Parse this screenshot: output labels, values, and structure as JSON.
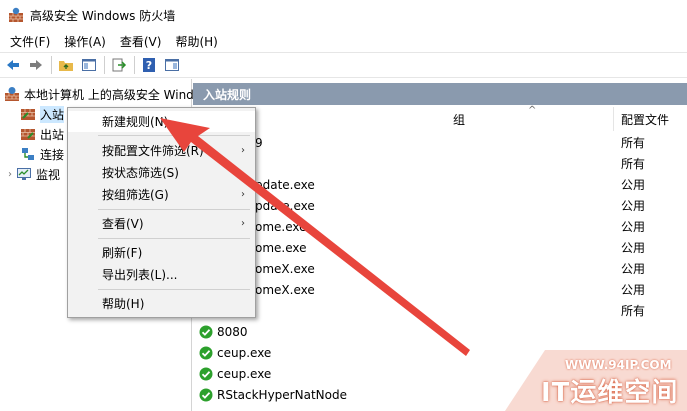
{
  "window": {
    "title": "高级安全 Windows 防火墙"
  },
  "menubar": [
    "文件(F)",
    "操作(A)",
    "查看(V)",
    "帮助(H)"
  ],
  "toolbar": {
    "icons": [
      "back-arrow-icon",
      "forward-arrow-icon",
      "folder-up-icon",
      "show-hide-tree-icon",
      "export-icon",
      "help-icon",
      "properties-icon"
    ]
  },
  "tree": {
    "root": "本地计算机 上的高级安全 Wind",
    "items": [
      {
        "label": "入站",
        "selected": true
      },
      {
        "label": "出站"
      },
      {
        "label": "连接"
      },
      {
        "label": "监视"
      }
    ]
  },
  "right": {
    "header": "入站规则",
    "columns": {
      "group": "组",
      "profile": "配置文件"
    },
    "rows": [
      {
        "name": "9",
        "profile": "所有",
        "icon": false
      },
      {
        "name": "",
        "profile": "所有",
        "icon": false
      },
      {
        "name": "pdate.exe",
        "profile": "公用",
        "icon": false
      },
      {
        "name": "pdate.exe",
        "profile": "公用",
        "icon": false
      },
      {
        "name": "ome.exe",
        "profile": "公用",
        "icon": false
      },
      {
        "name": "ome.exe",
        "profile": "公用",
        "icon": false
      },
      {
        "name": "omeX.exe",
        "profile": "公用",
        "icon": false
      },
      {
        "name": "omeX.exe",
        "profile": "公用",
        "icon": false
      },
      {
        "name": "",
        "profile": "所有",
        "icon": false
      },
      {
        "name": "8080",
        "profile": "",
        "icon": true
      },
      {
        "name": "ceup.exe",
        "profile": "",
        "icon": true
      },
      {
        "name": "ceup.exe",
        "profile": "",
        "icon": true
      },
      {
        "name": "RStackHyperNatNode",
        "profile": "",
        "icon": true
      }
    ]
  },
  "context_menu": {
    "items": [
      {
        "label": "新建规则(N)...",
        "submenu": false
      },
      {
        "label": "按配置文件筛选(R)",
        "submenu": true
      },
      {
        "label": "按状态筛选(S)",
        "submenu": false
      },
      {
        "label": "按组筛选(G)",
        "submenu": true
      },
      {
        "label": "查看(V)",
        "submenu": true
      },
      {
        "label": "刷新(F)",
        "submenu": false
      },
      {
        "label": "导出列表(L)...",
        "submenu": false
      },
      {
        "label": "帮助(H)",
        "submenu": false
      }
    ]
  },
  "watermark": {
    "url": "WWW.94IP.COM",
    "brand": "IT运维空间"
  },
  "colors": {
    "header_bg": "#8a9aae",
    "selection": "#cce8ff",
    "annotation_arrow": "#e8453c",
    "enabled_green": "#2ca02c"
  }
}
